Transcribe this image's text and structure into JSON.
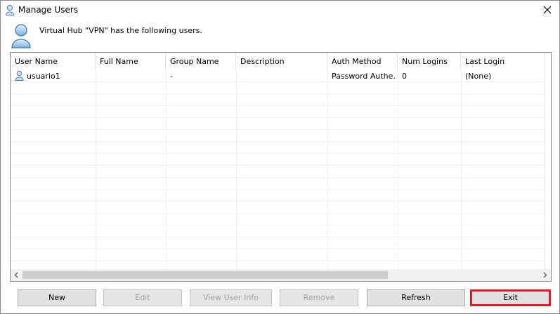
{
  "window": {
    "title": "Manage Users",
    "header_message": "Virtual Hub \"VPN\" has the following users."
  },
  "table": {
    "columns": [
      "User Name",
      "Full Name",
      "Group Name",
      "Description",
      "Auth Method",
      "Num Logins",
      "Last Login"
    ],
    "rows": [
      {
        "user_name": "usuario1",
        "full_name": "",
        "group_name": "-",
        "description": "",
        "auth_method": "Password Authe…",
        "num_logins": "0",
        "last_login": "(None)"
      }
    ]
  },
  "buttons": {
    "new": "New",
    "edit": "Edit",
    "view_user_info": "View User Info",
    "remove": "Remove",
    "refresh": "Refresh",
    "exit": "Exit"
  },
  "colors": {
    "exit_highlight": "#e11b22",
    "icon_blue": "#5b9bd5"
  },
  "icons": [
    "user-icon",
    "close-icon",
    "arrow-left-icon",
    "arrow-right-icon"
  ]
}
